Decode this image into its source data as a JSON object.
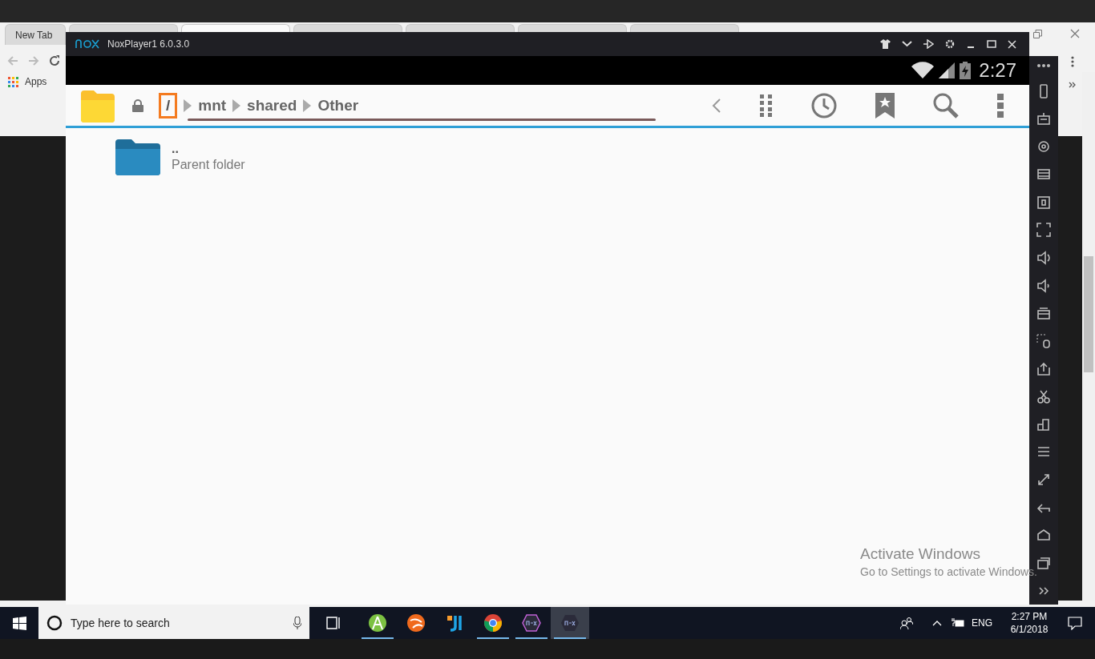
{
  "browser": {
    "tabs": [
      {
        "label": "New Tab",
        "selected": false
      },
      {
        "selected": false
      },
      {
        "selected": true
      },
      {
        "selected": false
      },
      {
        "selected": false
      },
      {
        "selected": false
      },
      {
        "selected": false
      }
    ],
    "bookmarks": [
      {
        "label": "Apps"
      }
    ]
  },
  "emulator": {
    "window": {
      "title": "NoxPlayer1 6.0.3.0"
    },
    "status_bar": {
      "time": "2:27"
    },
    "path": [
      {
        "label": "/",
        "selected": true
      },
      {
        "label": "mnt",
        "selected": false
      },
      {
        "label": "shared",
        "selected": false
      },
      {
        "label": "Other",
        "selected": false
      }
    ],
    "files": [
      {
        "name": "..",
        "description": "Parent folder"
      }
    ]
  },
  "activation_notice": {
    "title": "Activate Windows",
    "message": "Go to Settings to activate Windows."
  },
  "taskbar": {
    "search": {
      "placeholder": "Type here to search"
    },
    "apps": [
      {
        "kind": "android-studio",
        "running": true
      },
      {
        "kind": "orange-globe",
        "running": false
      },
      {
        "kind": "ji",
        "running": false
      },
      {
        "kind": "chrome",
        "running": true
      },
      {
        "kind": "nox-multi",
        "running": true
      },
      {
        "kind": "nox",
        "running": true,
        "selected": true
      }
    ],
    "language": "ENG",
    "time": "2:27 PM",
    "date": "6/1/2018"
  }
}
